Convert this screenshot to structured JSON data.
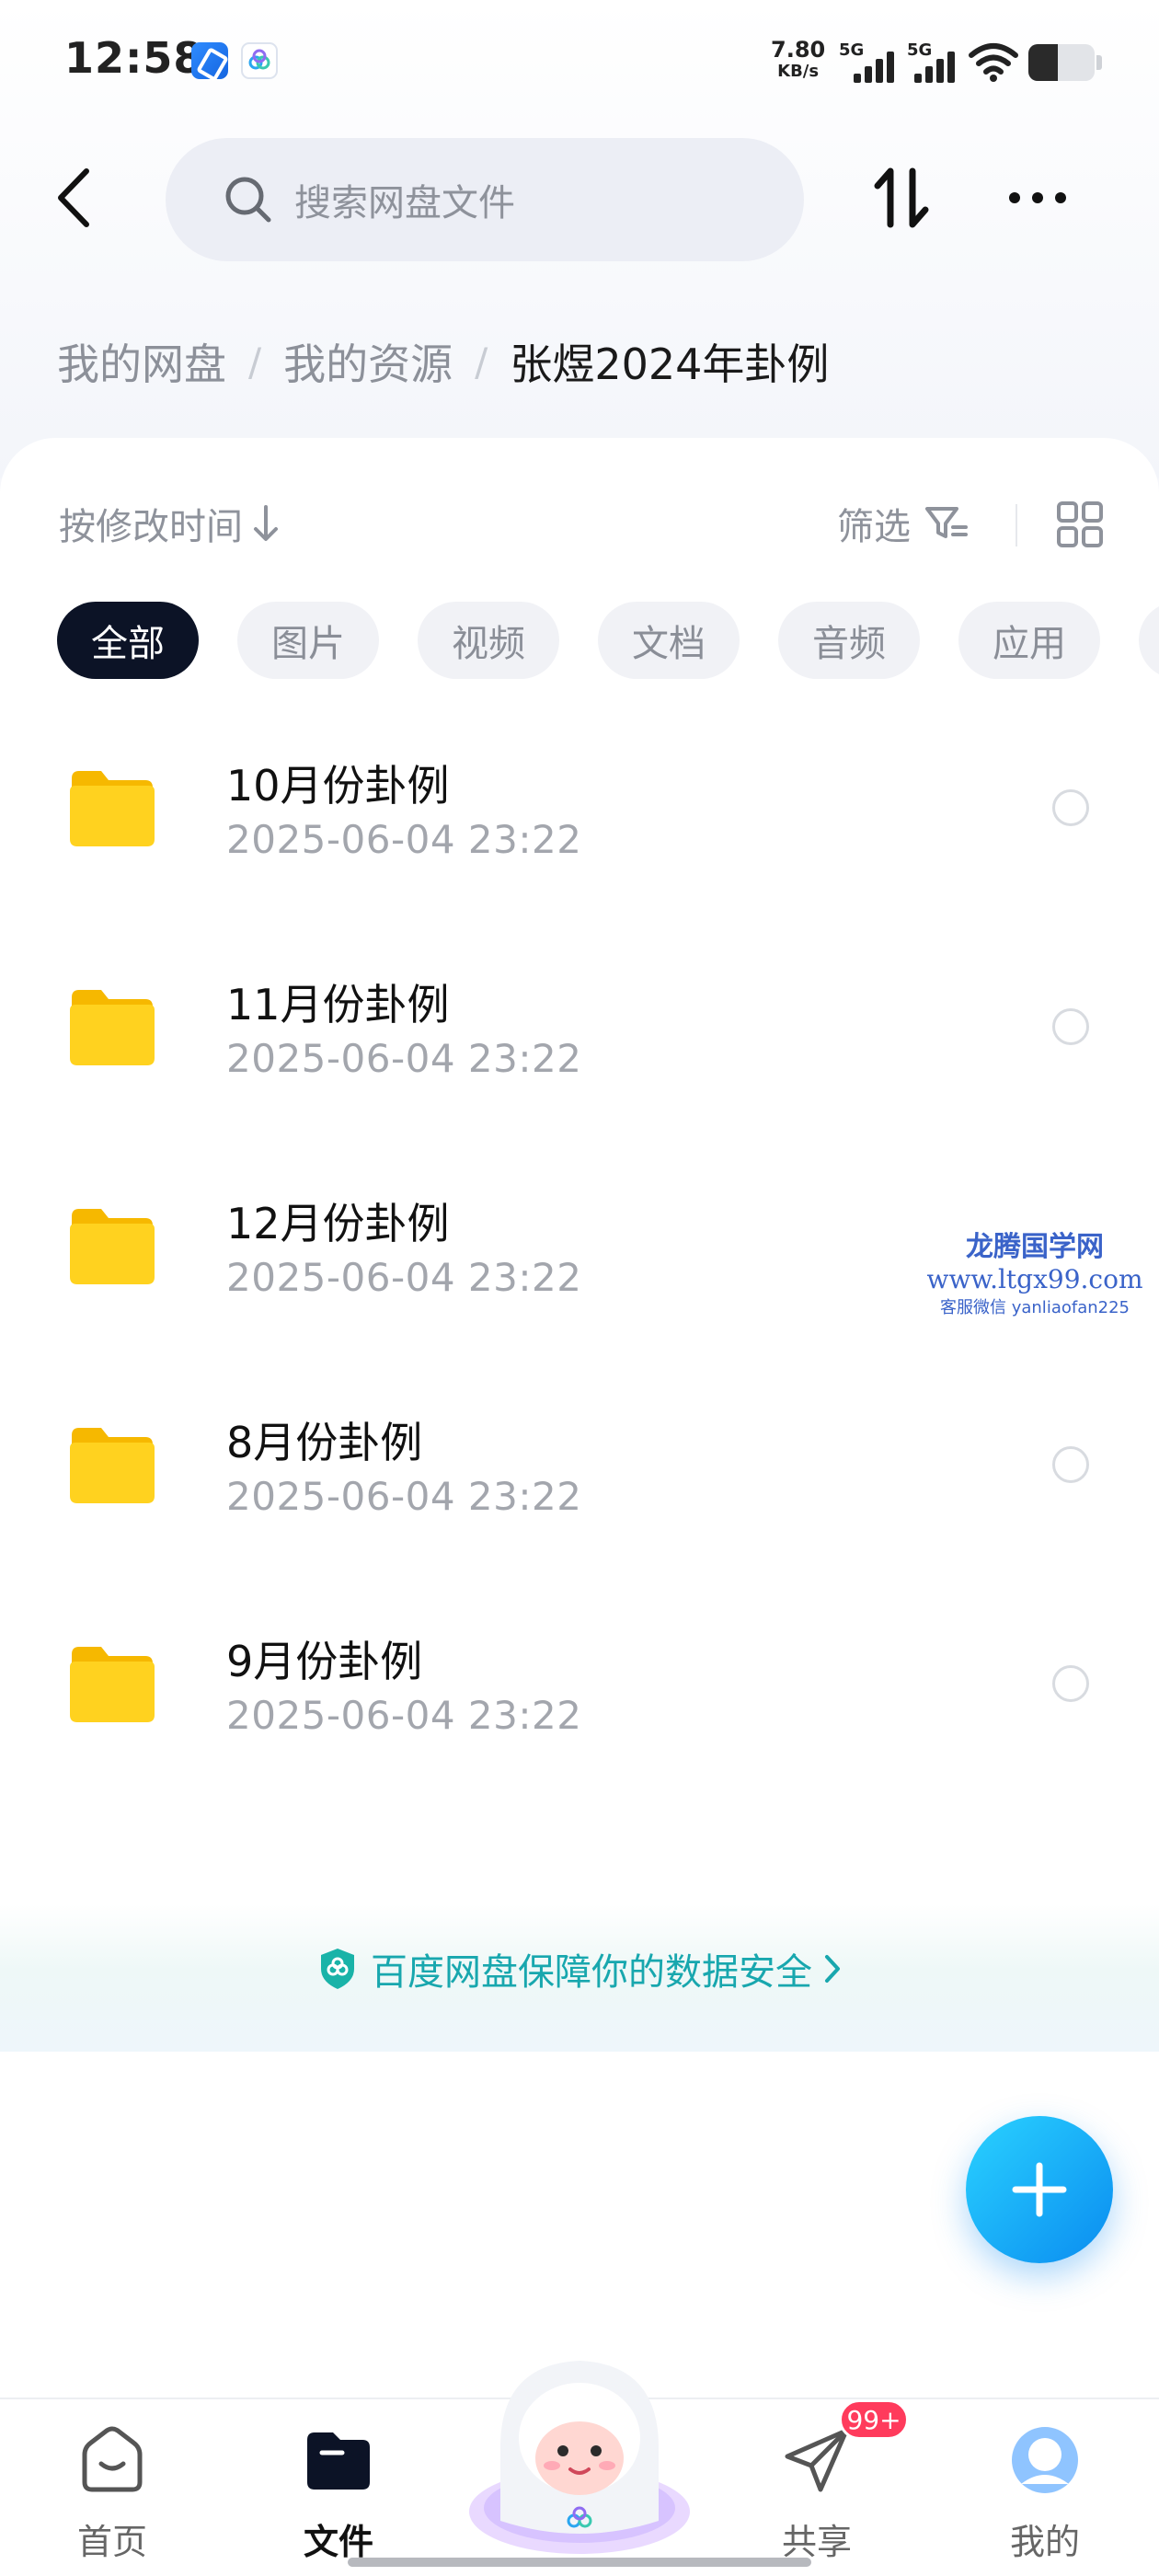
{
  "status_bar": {
    "time": "12:58",
    "net_speed_value": "7.80",
    "net_speed_unit": "KB/s",
    "signal_1_label": "5G",
    "signal_2_label": "5G",
    "battery_level": 0.45,
    "icons": [
      "app-notification-icon",
      "baidu-netdisk-icon",
      "signal-icon",
      "wifi-icon",
      "battery-icon"
    ]
  },
  "header": {
    "search_placeholder": "搜索网盘文件",
    "icons": [
      "back-arrow-icon",
      "search-icon",
      "transfer-icon",
      "more-icon"
    ]
  },
  "breadcrumb": {
    "items": [
      "我的网盘",
      "我的资源"
    ],
    "separator": "/",
    "current": "张煜2024年卦例"
  },
  "toolbar": {
    "sort_label": "按修改时间",
    "filter_label": "筛选"
  },
  "chips": [
    "全部",
    "图片",
    "视频",
    "文档",
    "音频",
    "应用"
  ],
  "files": [
    {
      "name": "10月份卦例",
      "date": "2025-06-04  23:22"
    },
    {
      "name": "11月份卦例",
      "date": "2025-06-04  23:22"
    },
    {
      "name": "12月份卦例",
      "date": "2025-06-04  23:22"
    },
    {
      "name": "8月份卦例",
      "date": "2025-06-04  23:22"
    },
    {
      "name": "9月份卦例",
      "date": "2025-06-04  23:22"
    }
  ],
  "watermark": {
    "line1": "龙腾国学网",
    "line2": "www.ltgx99.com",
    "line3": "客服微信 yanliaofan225"
  },
  "security_banner": {
    "text": "百度网盘保障你的数据安全"
  },
  "bottom_nav": {
    "items": [
      {
        "label": "首页",
        "icon": "home-icon"
      },
      {
        "label": "文件",
        "icon": "folder-icon"
      },
      {
        "label": "共享",
        "icon": "share-icon"
      },
      {
        "label": "我的",
        "icon": "profile-icon"
      }
    ],
    "share_badge": "99+"
  },
  "colors": {
    "accent": "#18a7ae",
    "fab": "#0a8cf0",
    "chip_active": "#0c1326",
    "badge": "#ff3b5c",
    "folder": "#ffd21f"
  }
}
